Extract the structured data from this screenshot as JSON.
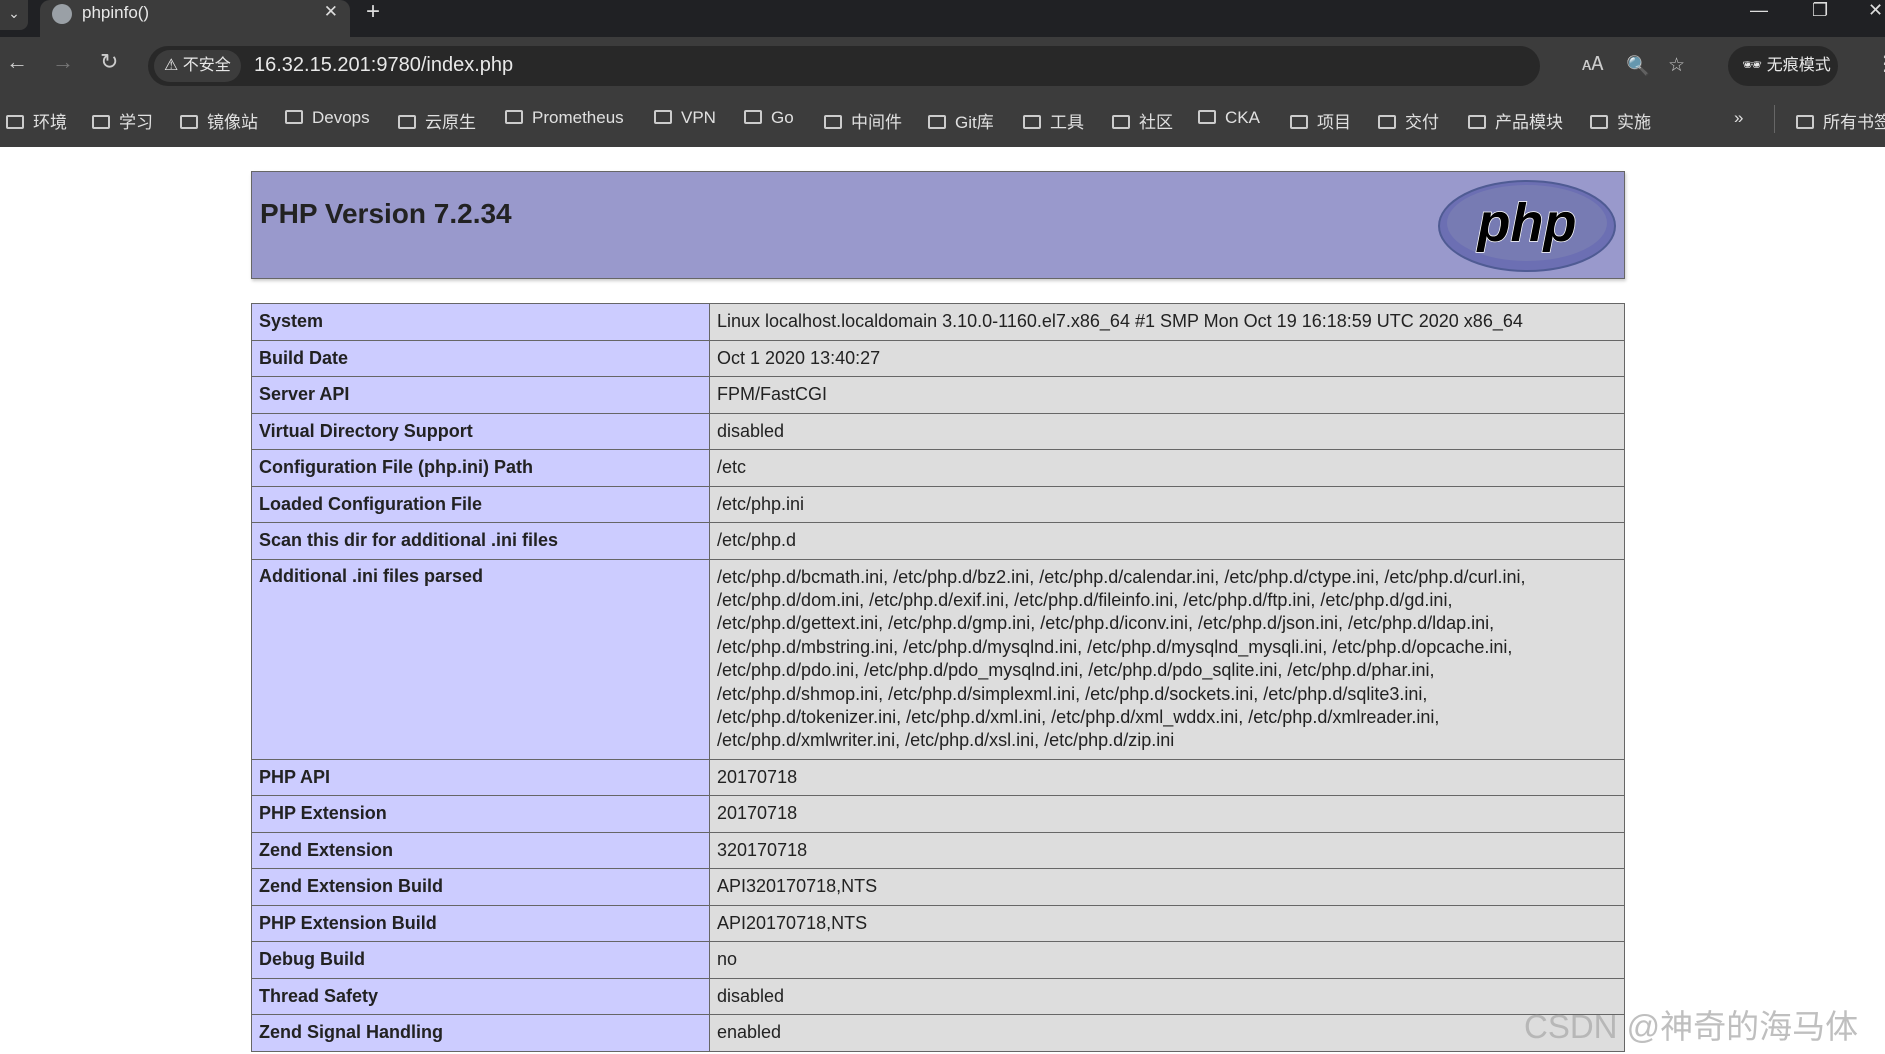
{
  "browser": {
    "tab_title": "phpinfo()",
    "url": "16.32.15.201:9780/index.php",
    "security_label": "不安全",
    "incognito_label": "无痕模式",
    "bookmarks": [
      "环境",
      "学习",
      "镜像站",
      "Devops",
      "云原生",
      "Prometheus",
      "VPN",
      "Go",
      "中间件",
      "Git库",
      "工具",
      "社区",
      "CKA",
      "项目",
      "交付",
      "产品模块",
      "实施"
    ],
    "all_bookmarks_label": "所有书签"
  },
  "page": {
    "title": "PHP Version 7.2.34",
    "logo_text": "php",
    "rows": [
      {
        "key": "System",
        "value": "Linux localhost.localdomain 3.10.0-1160.el7.x86_64 #1 SMP Mon Oct 19 16:18:59 UTC 2020 x86_64"
      },
      {
        "key": "Build Date",
        "value": "Oct 1 2020 13:40:27"
      },
      {
        "key": "Server API",
        "value": "FPM/FastCGI"
      },
      {
        "key": "Virtual Directory Support",
        "value": "disabled"
      },
      {
        "key": "Configuration File (php.ini) Path",
        "value": "/etc"
      },
      {
        "key": "Loaded Configuration File",
        "value": "/etc/php.ini"
      },
      {
        "key": "Scan this dir for additional .ini files",
        "value": "/etc/php.d"
      },
      {
        "key": "Additional .ini files parsed",
        "lines": [
          "/etc/php.d/bcmath.ini, /etc/php.d/bz2.ini, /etc/php.d/calendar.ini, /etc/php.d/ctype.ini, /etc/php.d/curl.ini,",
          "/etc/php.d/dom.ini, /etc/php.d/exif.ini, /etc/php.d/fileinfo.ini, /etc/php.d/ftp.ini, /etc/php.d/gd.ini,",
          "/etc/php.d/gettext.ini, /etc/php.d/gmp.ini, /etc/php.d/iconv.ini, /etc/php.d/json.ini, /etc/php.d/ldap.ini,",
          "/etc/php.d/mbstring.ini, /etc/php.d/mysqlnd.ini, /etc/php.d/mysqlnd_mysqli.ini, /etc/php.d/opcache.ini,",
          "/etc/php.d/pdo.ini, /etc/php.d/pdo_mysqlnd.ini, /etc/php.d/pdo_sqlite.ini, /etc/php.d/phar.ini,",
          "/etc/php.d/shmop.ini, /etc/php.d/simplexml.ini, /etc/php.d/sockets.ini, /etc/php.d/sqlite3.ini,",
          "/etc/php.d/tokenizer.ini, /etc/php.d/xml.ini, /etc/php.d/xml_wddx.ini, /etc/php.d/xmlreader.ini,",
          "/etc/php.d/xmlwriter.ini, /etc/php.d/xsl.ini, /etc/php.d/zip.ini"
        ]
      },
      {
        "key": "PHP API",
        "value": "20170718"
      },
      {
        "key": "PHP Extension",
        "value": "20170718"
      },
      {
        "key": "Zend Extension",
        "value": "320170718"
      },
      {
        "key": "Zend Extension Build",
        "value": "API320170718,NTS"
      },
      {
        "key": "PHP Extension Build",
        "value": "API20170718,NTS"
      },
      {
        "key": "Debug Build",
        "value": "no"
      },
      {
        "key": "Thread Safety",
        "value": "disabled"
      },
      {
        "key": "Zend Signal Handling",
        "value": "enabled"
      }
    ]
  },
  "watermark": "CSDN @神奇的海马体",
  "colors": {
    "header": "#9999cc",
    "key_cell": "#ccccff",
    "value_cell": "#dddddd",
    "chrome_dark": "#202124",
    "chrome_toolbar": "#3c3c3c"
  }
}
